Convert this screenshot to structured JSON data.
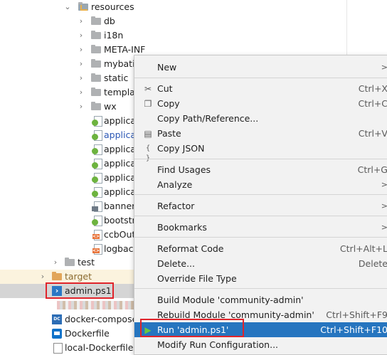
{
  "tree": {
    "items": [
      {
        "label": "resources"
      },
      {
        "label": "db"
      },
      {
        "label": "i18n"
      },
      {
        "label": "META-INF"
      },
      {
        "label": "mybatis"
      },
      {
        "label": "static"
      },
      {
        "label": "templates"
      },
      {
        "label": "wx"
      },
      {
        "label": "applicat"
      },
      {
        "label": "applicat"
      },
      {
        "label": "applicat"
      },
      {
        "label": "applicat"
      },
      {
        "label": "applicat"
      },
      {
        "label": "applicat"
      },
      {
        "label": "banner."
      },
      {
        "label": "bootstr"
      },
      {
        "label": "ccbOutr"
      },
      {
        "label": "logback"
      },
      {
        "label": "test"
      },
      {
        "label": "target"
      },
      {
        "label": "admin.ps1"
      },
      {
        "label": "docker-compose"
      },
      {
        "label": "Dockerfile"
      },
      {
        "label": "local-Dockerfile"
      }
    ]
  },
  "menu": {
    "new": {
      "label": "New",
      "arrow": ">"
    },
    "cut": {
      "label": "Cut",
      "shortcut": "Ctrl+X"
    },
    "copy": {
      "label": "Copy",
      "shortcut": "Ctrl+C"
    },
    "copy_path": {
      "label": "Copy Path/Reference..."
    },
    "paste": {
      "label": "Paste",
      "shortcut": "Ctrl+V"
    },
    "copy_json": {
      "label": "Copy JSON"
    },
    "find_usages": {
      "label": "Find Usages",
      "shortcut": "Ctrl+G"
    },
    "analyze": {
      "label": "Analyze",
      "arrow": ">"
    },
    "refactor": {
      "label": "Refactor",
      "arrow": ">"
    },
    "bookmarks": {
      "label": "Bookmarks",
      "arrow": ">"
    },
    "reformat": {
      "label": "Reformat Code",
      "shortcut": "Ctrl+Alt+L"
    },
    "delete": {
      "label": "Delete...",
      "shortcut": "Delete"
    },
    "override": {
      "label": "Override File Type"
    },
    "build_module": {
      "label": "Build Module 'community-admin'"
    },
    "rebuild_module": {
      "label": "Rebuild Module 'community-admin'",
      "shortcut": "Ctrl+Shift+F9"
    },
    "run": {
      "label": "Run 'admin.ps1'",
      "shortcut": "Ctrl+Shift+F10"
    },
    "modify_run": {
      "label": "Modify Run Configuration..."
    }
  },
  "colors": {
    "menu_highlight": "#2675bf",
    "annotation_red": "#e0242b",
    "selection_row": "#d5d5d5"
  }
}
